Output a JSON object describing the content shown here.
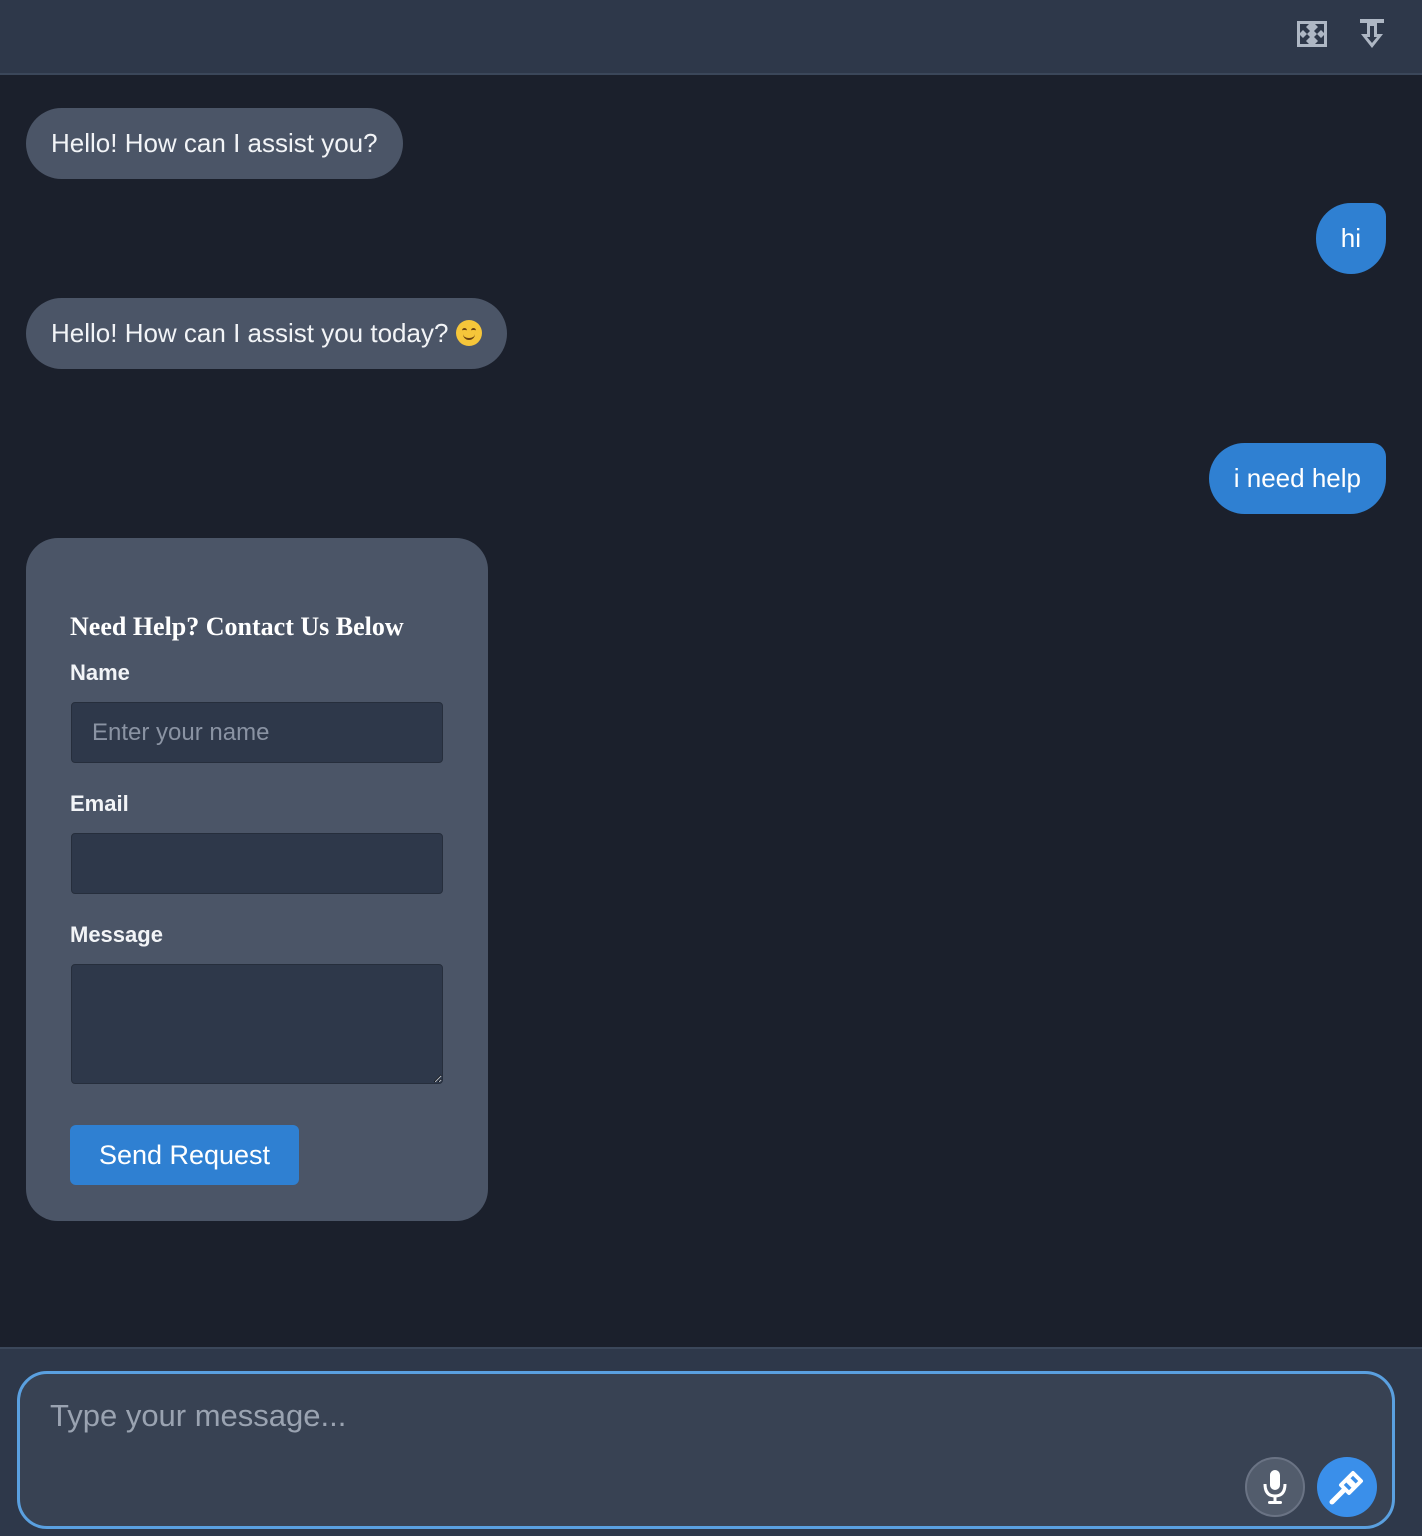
{
  "header": {
    "expand_icon": "expand-arrows-icon",
    "download_icon": "download-arrow-icon"
  },
  "messages": [
    {
      "role": "bot",
      "text": "Hello! How can I assist you?"
    },
    {
      "role": "user",
      "text": "hi"
    },
    {
      "role": "bot",
      "text": "Hello! How can I assist you today?",
      "emoji": "smiling-face-icon"
    },
    {
      "role": "user",
      "text": "i need help"
    }
  ],
  "form": {
    "title": "Need Help? Contact Us Below",
    "name_label": "Name",
    "name_placeholder": "Enter your name",
    "name_value": "",
    "email_label": "Email",
    "email_value": "",
    "message_label": "Message",
    "message_value": "",
    "submit_label": "Send Request"
  },
  "composer": {
    "placeholder": "Type your message...",
    "value": "",
    "mic_icon": "microphone-icon",
    "send_icon": "send-icon"
  },
  "colors": {
    "background": "#1b202c",
    "header": "#2e384a",
    "bot_bubble": "#4b5567",
    "user_bubble": "#2f80d2",
    "accent": "#3a8fea",
    "composer_border": "#5aa0e0"
  }
}
